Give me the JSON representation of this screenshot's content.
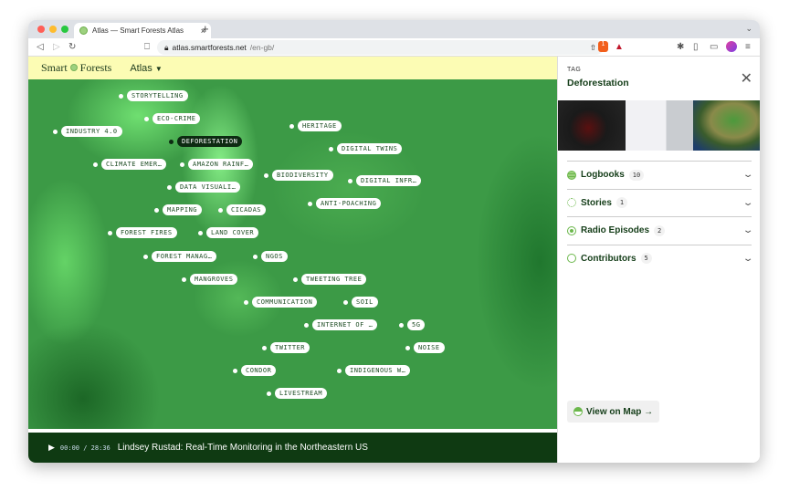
{
  "browser": {
    "tab_title": "Atlas — Smart Forests Atlas",
    "url_host": "atlas.smartforests.net",
    "url_path": "/en-gb/",
    "shield_badge": "1"
  },
  "nav": {
    "brand_left": "Smart",
    "brand_right": "Forests",
    "menu": "Atlas"
  },
  "map": {
    "labels": [
      "STORYTELLING",
      "ECO-CRIME",
      "INDUSTRY 4.0",
      "DEFORESTATION",
      "HERITAGE",
      "DIGITAL TWINS",
      "CLIMATE EMER…",
      "AMAZON RAINF…",
      "BIODIVERSITY",
      "DIGITAL INFR…",
      "DATA VISUALI…",
      "MAPPING",
      "CICADAS",
      "ANTI-POACHING",
      "FOREST FIRES",
      "LAND COVER",
      "FOREST MANAG…",
      "NGOS",
      "MANGROVES",
      "TWEETING TREE",
      "COMMUNICATION",
      "SOIL",
      "INTERNET OF …",
      "5G",
      "TWITTER",
      "NOISE",
      "CONDOR",
      "INDIGENOUS W…",
      "LIVESTREAM"
    ],
    "active": "DEFORESTATION"
  },
  "player": {
    "current": "00:00",
    "separator": "/",
    "duration": "28:36",
    "title": "Lindsey Rustad: Real-Time Monitoring in the Northeastern US"
  },
  "sidebar": {
    "kicker": "TAG",
    "title": "Deforestation",
    "sections": [
      {
        "label": "Logbooks",
        "count": "10"
      },
      {
        "label": "Stories",
        "count": "1"
      },
      {
        "label": "Radio Episodes",
        "count": "2"
      },
      {
        "label": "Contributors",
        "count": "5"
      }
    ],
    "view_on_map": "View on Map →"
  }
}
